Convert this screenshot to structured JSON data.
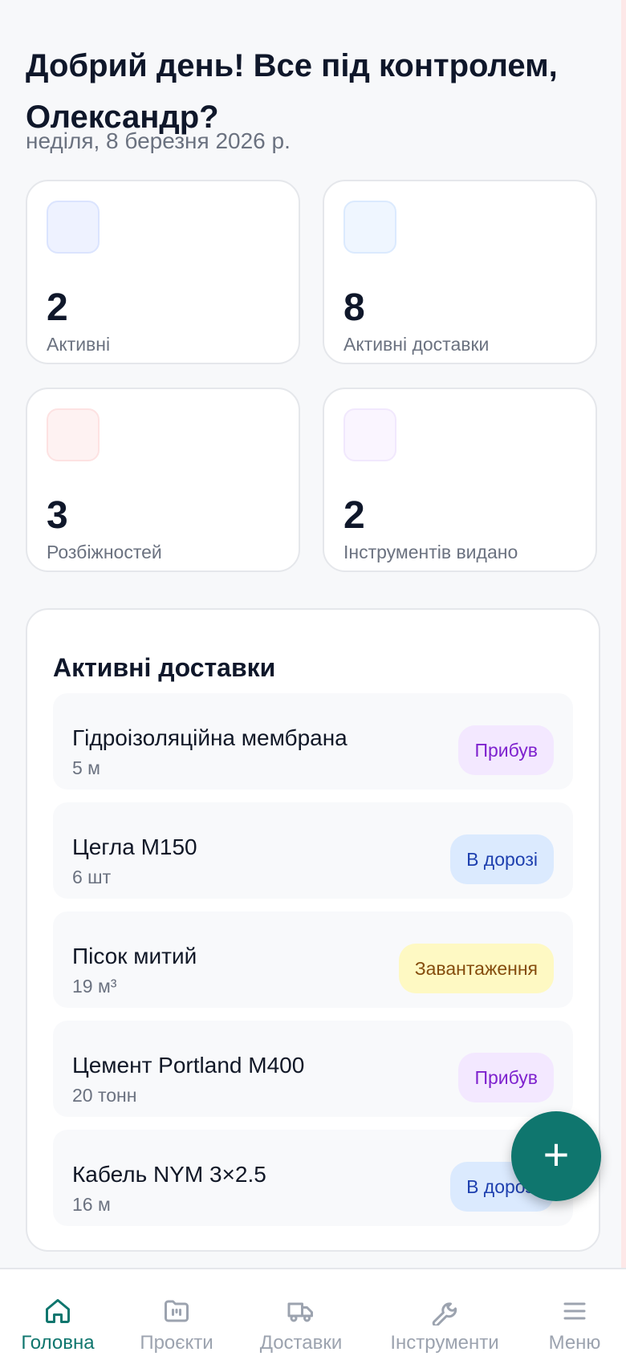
{
  "header": {
    "greeting": "Добрий день! Все під контролем, Олександр?",
    "date": "неділя, 8 березня 2026 р."
  },
  "stats": [
    {
      "value": "2",
      "label": "Активні",
      "icon": "stat-icon-blue",
      "color": "#eef2ff"
    },
    {
      "value": "8",
      "label": "Активні доставки",
      "icon": "stat-icon-lightblue",
      "color": "#eff6ff"
    },
    {
      "value": "3",
      "label": "Розбіжностей",
      "icon": "stat-icon-red",
      "color": "#fef2f2"
    },
    {
      "value": "2",
      "label": "Інструментів видано",
      "icon": "stat-icon-purple",
      "color": "#faf5ff"
    }
  ],
  "deliveries": {
    "title": "Активні доставки",
    "items": [
      {
        "name": "Гідроізоляційна мембрана",
        "qty": "5 м",
        "status": "Прибув",
        "status_bg": "#f3e8ff",
        "status_fg": "#7e22ce"
      },
      {
        "name": "Цегла M150",
        "qty": "6 шт",
        "status": "В дорозі",
        "status_bg": "#dbeafe",
        "status_fg": "#1e40af"
      },
      {
        "name": "Пісок митий",
        "qty": "19 м³",
        "status": "Завантаження",
        "status_bg": "#fef9c3",
        "status_fg": "#854d0e"
      },
      {
        "name": "Цемент Portland M400",
        "qty": "20 тонн",
        "status": "Прибув",
        "status_bg": "#f3e8ff",
        "status_fg": "#7e22ce"
      },
      {
        "name": "Кабель NYM 3×2.5",
        "qty": "16 м",
        "status": "В дорозі",
        "status_bg": "#dbeafe",
        "status_fg": "#1e40af"
      }
    ]
  },
  "fab": {
    "icon": "plus-icon",
    "symbol": "+"
  },
  "nav": [
    {
      "label": "Головна",
      "icon": "home-icon",
      "active": true
    },
    {
      "label": "Проєкти",
      "icon": "folder-icon",
      "active": false
    },
    {
      "label": "Доставки",
      "icon": "truck-icon",
      "active": false
    },
    {
      "label": "Інструменти",
      "icon": "wrench-icon",
      "active": false
    },
    {
      "label": "Меню",
      "icon": "menu-icon",
      "active": false
    }
  ],
  "colors": {
    "accent": "#0f766e",
    "inactive": "#9ca3af"
  }
}
